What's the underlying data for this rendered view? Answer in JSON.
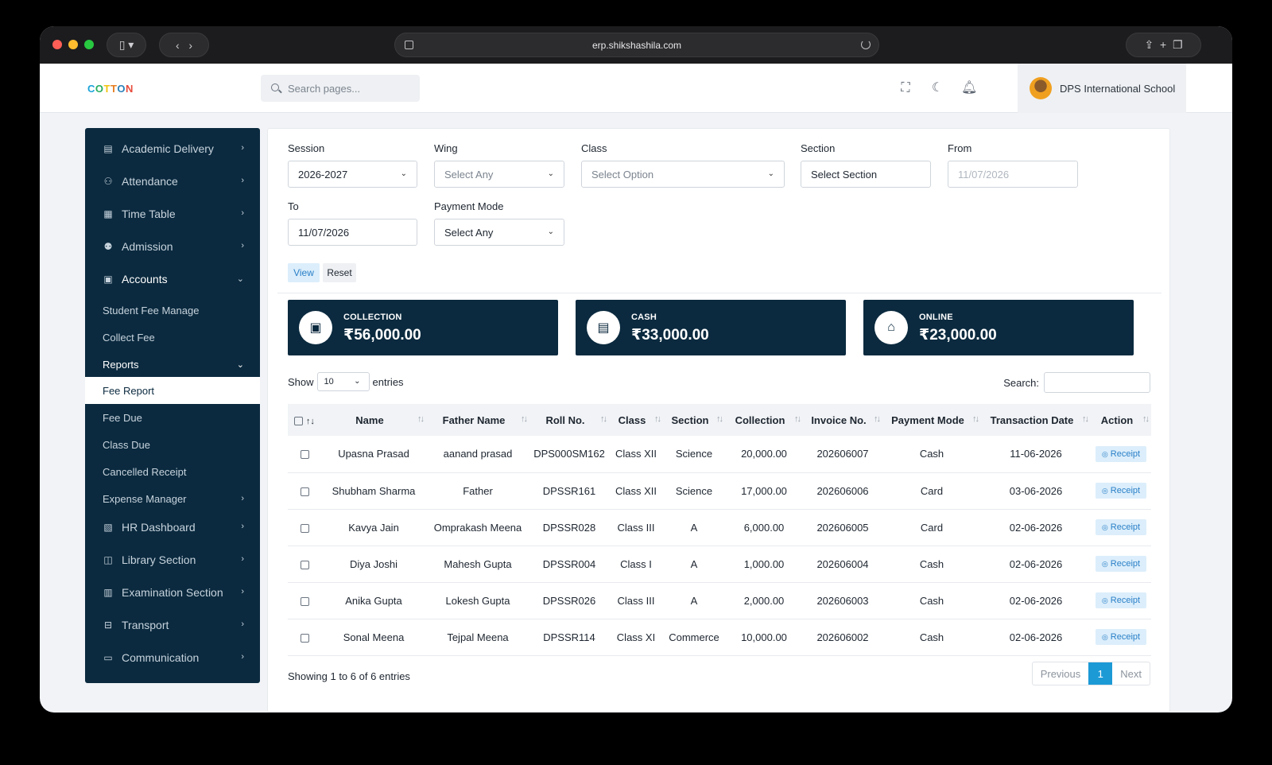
{
  "browser": {
    "url": "erp.shikshashila.com"
  },
  "header": {
    "logo_letters": [
      "C",
      "O",
      "T",
      "T",
      "O",
      "N"
    ],
    "search_placeholder": "Search pages...",
    "school_name": "DPS International School"
  },
  "sidebar": {
    "items": [
      {
        "label": "Academic Delivery"
      },
      {
        "label": "Attendance"
      },
      {
        "label": "Time Table"
      },
      {
        "label": "Admission"
      },
      {
        "label": "Accounts"
      }
    ],
    "accounts_sub": [
      {
        "label": "Student Fee Manage"
      },
      {
        "label": "Collect Fee"
      },
      {
        "label": "Reports"
      }
    ],
    "reports_sub": [
      {
        "label": "Fee Report"
      },
      {
        "label": "Fee Due"
      },
      {
        "label": "Class Due"
      },
      {
        "label": "Cancelled Receipt"
      },
      {
        "label": "Expense Manager"
      }
    ],
    "bottom_items": [
      {
        "label": "HR Dashboard"
      },
      {
        "label": "Library Section"
      },
      {
        "label": "Examination Section"
      },
      {
        "label": "Transport"
      },
      {
        "label": "Communication"
      }
    ]
  },
  "filters": {
    "session": {
      "label": "Session",
      "value": "2026-2027"
    },
    "wing": {
      "label": "Wing",
      "value": "Select Any"
    },
    "class": {
      "label": "Class",
      "value": "Select Option"
    },
    "section": {
      "label": "Section",
      "value": "Select Section"
    },
    "from": {
      "label": "From",
      "value": "11/07/2026"
    },
    "to": {
      "label": "To",
      "value": "11/07/2026"
    },
    "payment_mode": {
      "label": "Payment Mode",
      "value": "Select Any"
    },
    "view_label": "View",
    "reset_label": "Reset"
  },
  "cards": [
    {
      "title": "COLLECTION",
      "amount": "₹56,000.00"
    },
    {
      "title": "CASH",
      "amount": "₹33,000.00"
    },
    {
      "title": "ONLINE",
      "amount": "₹23,000.00"
    }
  ],
  "table_controls": {
    "show_label": "Show",
    "entries_value": "10",
    "entries_label": "entries",
    "search_label": "Search:"
  },
  "table": {
    "headers": [
      "Name",
      "Father Name",
      "Roll No.",
      "Class",
      "Section",
      "Collection",
      "Invoice No.",
      "Payment Mode",
      "Transaction Date",
      "Action"
    ],
    "rows": [
      {
        "name": "Upasna Prasad",
        "father": "aanand prasad",
        "roll": "DPS000SM162",
        "class": "Class XII",
        "section": "Science",
        "collection": "20,000.00",
        "invoice": "202606007",
        "mode": "Cash",
        "date": "11-06-2026",
        "action": "Receipt"
      },
      {
        "name": "Shubham Sharma",
        "father": "Father",
        "roll": "DPSSR161",
        "class": "Class XII",
        "section": "Science",
        "collection": "17,000.00",
        "invoice": "202606006",
        "mode": "Card",
        "date": "03-06-2026",
        "action": "Receipt"
      },
      {
        "name": "Kavya Jain",
        "father": "Omprakash Meena",
        "roll": "DPSSR028",
        "class": "Class III",
        "section": "A",
        "collection": "6,000.00",
        "invoice": "202606005",
        "mode": "Card",
        "date": "02-06-2026",
        "action": "Receipt"
      },
      {
        "name": "Diya Joshi",
        "father": "Mahesh Gupta",
        "roll": "DPSSR004",
        "class": "Class I",
        "section": "A",
        "collection": "1,000.00",
        "invoice": "202606004",
        "mode": "Cash",
        "date": "02-06-2026",
        "action": "Receipt"
      },
      {
        "name": "Anika Gupta",
        "father": "Lokesh Gupta",
        "roll": "DPSSR026",
        "class": "Class III",
        "section": "A",
        "collection": "2,000.00",
        "invoice": "202606003",
        "mode": "Cash",
        "date": "02-06-2026",
        "action": "Receipt"
      },
      {
        "name": "Sonal Meena",
        "father": "Tejpal Meena",
        "roll": "DPSSR114",
        "class": "Class XI",
        "section": "Commerce",
        "collection": "10,000.00",
        "invoice": "202606002",
        "mode": "Cash",
        "date": "02-06-2026",
        "action": "Receipt"
      }
    ]
  },
  "footer": {
    "showing": "Showing 1 to 6 of 6 entries",
    "previous": "Previous",
    "page": "1",
    "next": "Next"
  },
  "colors": {
    "sidebar_bg": "#0b2a3f",
    "accent": "#1c9ad6"
  }
}
